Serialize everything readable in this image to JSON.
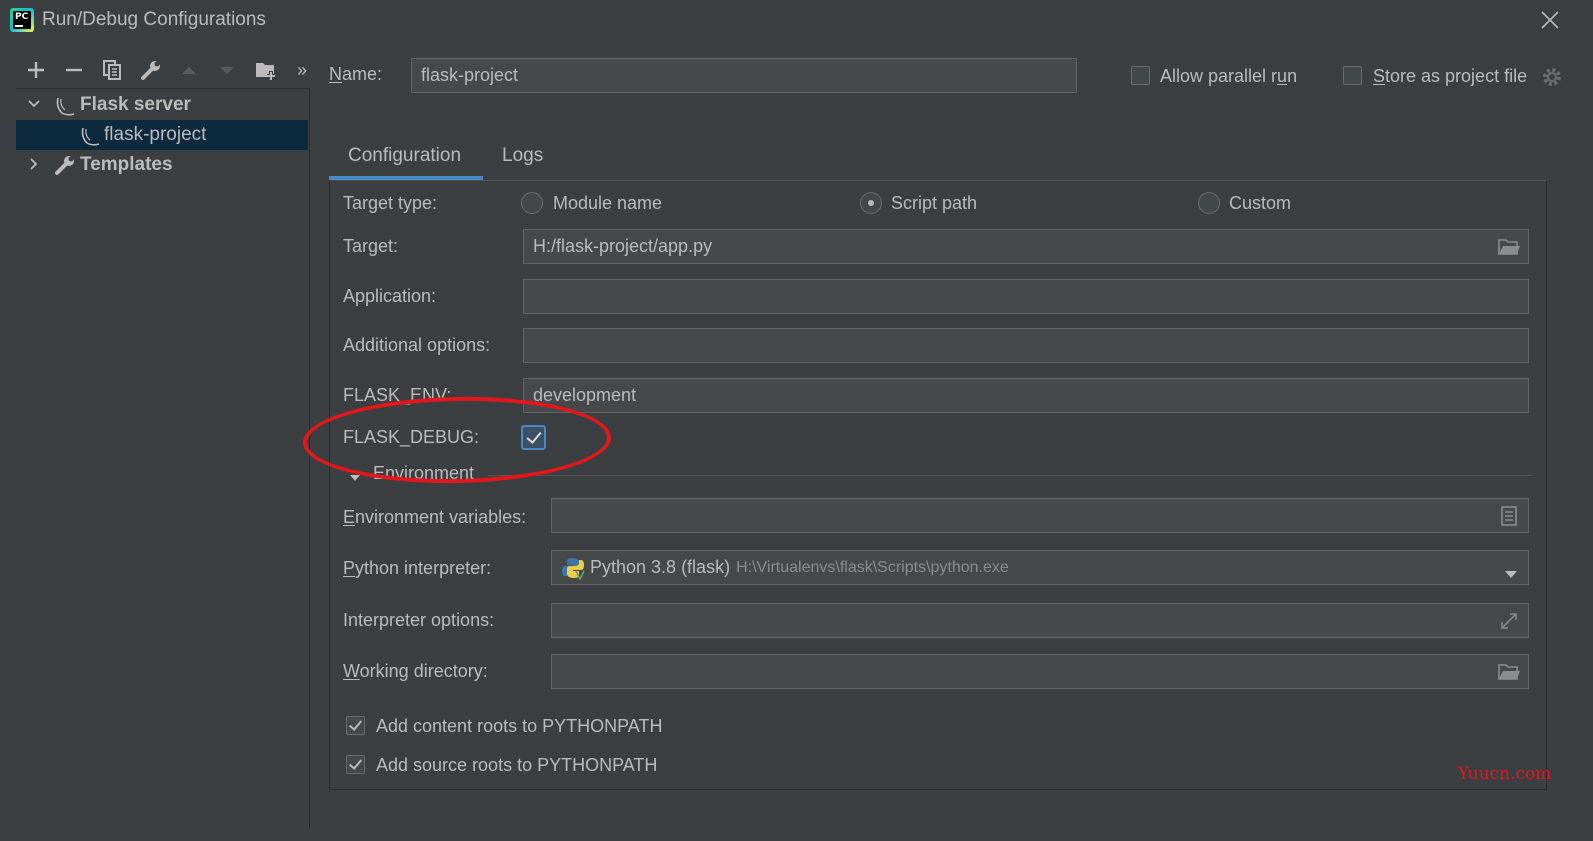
{
  "window": {
    "title": "Run/Debug Configurations",
    "app_icon": "pycharm-icon",
    "app_icon_text": "PC"
  },
  "toolbar": {
    "icons": [
      "add-icon",
      "remove-icon",
      "copy-icon",
      "wrench-icon",
      "move-up-icon",
      "move-down-icon",
      "new-folder-icon",
      "more-icon"
    ],
    "more_label": "»"
  },
  "tree": {
    "groups": [
      {
        "label": "Flask server",
        "icon": "flask-icon",
        "expanded": true,
        "children": [
          {
            "label": "flask-project",
            "icon": "flask-icon",
            "selected": true
          }
        ]
      },
      {
        "label": "Templates",
        "icon": "wrench-icon",
        "expanded": false
      }
    ]
  },
  "header": {
    "name_label": "Name:",
    "name_value": "flask-project",
    "allow_parallel_label": "Allow parallel run",
    "allow_parallel_checked": false,
    "store_project_label": "Store as project file",
    "store_project_checked": false
  },
  "tabs": [
    {
      "label": "Configuration",
      "active": true
    },
    {
      "label": "Logs",
      "active": false
    }
  ],
  "config": {
    "target_type_label": "Target type:",
    "target_types": [
      {
        "label": "Module name",
        "selected": false
      },
      {
        "label": "Script path",
        "selected": true
      },
      {
        "label": "Custom",
        "selected": false
      }
    ],
    "target_label": "Target:",
    "target_value": "H:/flask-project/app.py",
    "application_label": "Application:",
    "application_value": "",
    "additional_options_label": "Additional options:",
    "additional_options_value": "",
    "flask_env_label": "FLASK_ENV:",
    "flask_env_value": "development",
    "flask_debug_label": "FLASK_DEBUG:",
    "flask_debug_checked": true,
    "environment_section_label": "Environment",
    "env_vars_label": "Environment variables:",
    "env_vars_value": "",
    "python_interpreter_label": "Python interpreter:",
    "python_interpreter_name": "Python 3.8 (flask)",
    "python_interpreter_path": "H:\\Virtualenvs\\flask\\Scripts\\python.exe",
    "interpreter_options_label": "Interpreter options:",
    "interpreter_options_value": "",
    "working_directory_label": "Working directory:",
    "working_directory_value": "",
    "add_content_roots_label": "Add content roots to PYTHONPATH",
    "add_content_roots_checked": true,
    "add_source_roots_label": "Add source roots to PYTHONPATH",
    "add_source_roots_checked": true
  },
  "watermark": "Yuucn.com",
  "colors": {
    "background": "#3c3f41",
    "selection": "#0d293e",
    "accent": "#4a88c7",
    "annotation": "#e6171b"
  }
}
